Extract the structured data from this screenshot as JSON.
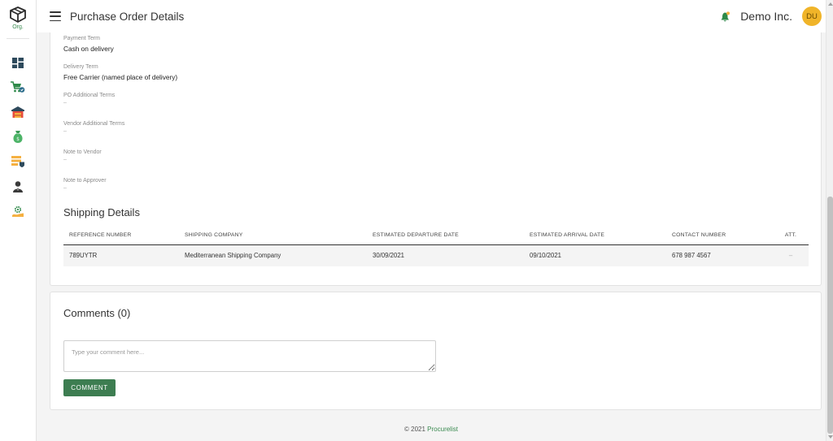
{
  "app": {
    "org_label": "Org.",
    "page_title": "Purchase Order Details",
    "company_name": "Demo Inc.",
    "avatar_initials": "DU"
  },
  "sidebar": {
    "items": [
      {
        "name": "dashboard-icon"
      },
      {
        "name": "cart-icon"
      },
      {
        "name": "warehouse-icon"
      },
      {
        "name": "money-bag-icon"
      },
      {
        "name": "invoice-icon"
      },
      {
        "name": "user-icon"
      },
      {
        "name": "settings-icon"
      }
    ]
  },
  "terms": [
    {
      "label": "Payment Term",
      "value": "Cash on delivery"
    },
    {
      "label": "Delivery Term",
      "value": "Free Carrier (named place of delivery)"
    },
    {
      "label": "PO Additional Terms",
      "value": "–"
    },
    {
      "label": "Vendor Additional Terms",
      "value": "–"
    },
    {
      "label": "Note to Vendor",
      "value": "–"
    },
    {
      "label": "Note to Approver",
      "value": "–"
    }
  ],
  "shipping": {
    "title": "Shipping Details",
    "columns": [
      "REFERENCE NUMBER",
      "SHIPPING COMPANY",
      "ESTIMATED DEPARTURE DATE",
      "ESTIMATED ARRIVAL DATE",
      "CONTACT NUMBER",
      "ATT."
    ],
    "rows": [
      [
        "789UYTR",
        "Mediterranean Shipping Company",
        "30/09/2021",
        "09/10/2021",
        "678 987 4567",
        "–"
      ]
    ]
  },
  "comments": {
    "title": "Comments (0)",
    "placeholder": "Type your comment here...",
    "button_label": "COMMENT"
  },
  "footer": {
    "copyright": "© 2021",
    "brand": "Procurelist"
  },
  "colors": {
    "accent_green": "#3d7d51",
    "avatar_bg": "#f0b429"
  }
}
